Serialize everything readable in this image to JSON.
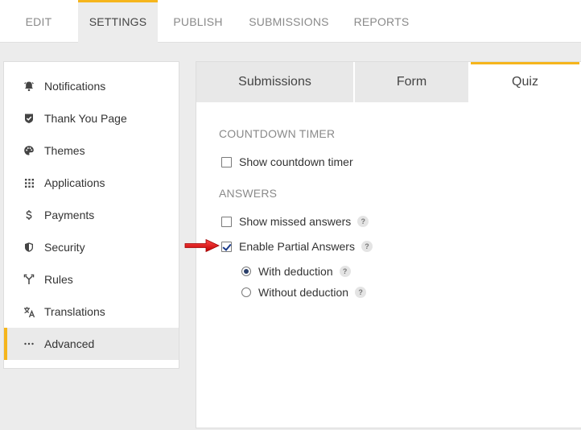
{
  "topnav": {
    "tabs": [
      {
        "label": "EDIT"
      },
      {
        "label": "SETTINGS"
      },
      {
        "label": "PUBLISH"
      },
      {
        "label": "SUBMISSIONS"
      },
      {
        "label": "REPORTS"
      }
    ],
    "active": "SETTINGS"
  },
  "sidebar": {
    "items": [
      {
        "label": "Notifications",
        "icon": "bell-icon"
      },
      {
        "label": "Thank You Page",
        "icon": "shield-check-icon"
      },
      {
        "label": "Themes",
        "icon": "palette-icon"
      },
      {
        "label": "Applications",
        "icon": "grid-icon"
      },
      {
        "label": "Payments",
        "icon": "dollar-icon"
      },
      {
        "label": "Security",
        "icon": "shield-icon"
      },
      {
        "label": "Rules",
        "icon": "fork-icon"
      },
      {
        "label": "Translations",
        "icon": "translate-icon"
      },
      {
        "label": "Advanced",
        "icon": "more-icon"
      }
    ],
    "active": "Advanced"
  },
  "subtabs": {
    "tabs": [
      {
        "label": "Submissions"
      },
      {
        "label": "Form"
      },
      {
        "label": "Quiz"
      }
    ],
    "active": "Quiz"
  },
  "quiz": {
    "countdown": {
      "title": "COUNTDOWN TIMER",
      "show_timer_label": "Show countdown timer",
      "show_timer_checked": false
    },
    "answers": {
      "title": "ANSWERS",
      "show_missed_label": "Show missed answers",
      "show_missed_checked": false,
      "partial_label": "Enable Partial Answers",
      "partial_checked": true,
      "with_deduction_label": "With deduction",
      "without_deduction_label": "Without deduction",
      "selected": "With deduction"
    },
    "help_glyph": "?"
  },
  "colors": {
    "accent": "#f5b51c",
    "annotation_arrow": "#e0141a"
  }
}
